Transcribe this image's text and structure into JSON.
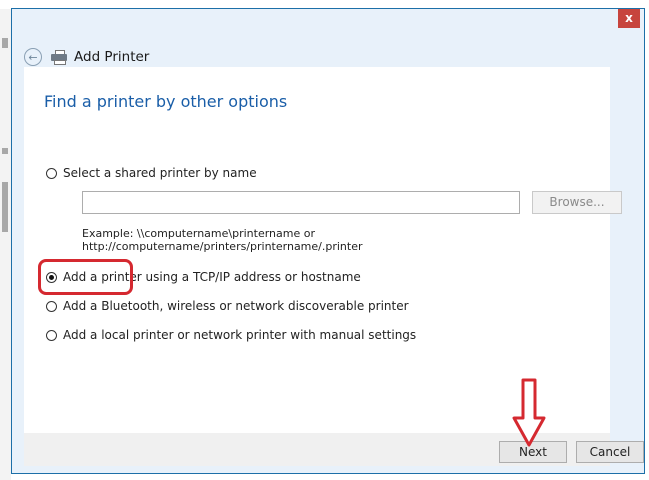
{
  "window": {
    "title": "Add Printer",
    "close_glyph": "x"
  },
  "heading": "Find a printer by other options",
  "options": [
    {
      "label": "Select a shared printer by name",
      "checked": false
    },
    {
      "label": "Add a printer using a TCP/IP address or hostname",
      "checked": true
    },
    {
      "label": "Add a Bluetooth, wireless or network discoverable printer",
      "checked": false
    },
    {
      "label": "Add a local printer or network printer with manual settings",
      "checked": false
    }
  ],
  "shared_printer": {
    "value": "",
    "browse_label": "Browse...",
    "example_line1": "Example: \\\\computername\\printername or",
    "example_line2": "http://computername/printers/printername/.printer"
  },
  "footer": {
    "next_label": "Next",
    "cancel_label": "Cancel"
  },
  "colors": {
    "window_border": "#1c6fa8",
    "heading": "#1a5ea8",
    "close_button": "#c7443d",
    "annotation": "#d52930"
  },
  "icons": [
    "back-arrow-icon",
    "printer-icon",
    "close-icon",
    "down-arrow-annotation-icon"
  ]
}
